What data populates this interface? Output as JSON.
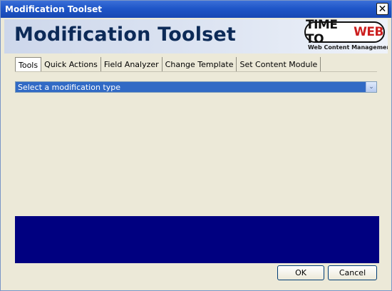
{
  "window": {
    "title": "Modification Toolset",
    "close_glyph": "✕"
  },
  "header": {
    "title": "Modification Toolset",
    "logo": {
      "part1": "TIME TO ",
      "part2": "WEB",
      "tagline": "Web Content Management"
    }
  },
  "tabs": [
    {
      "label": "Tools",
      "active": true
    },
    {
      "label": "Quick Actions",
      "active": false
    },
    {
      "label": "Field Analyzer",
      "active": false
    },
    {
      "label": "Change Template",
      "active": false
    },
    {
      "label": "Set Content Module",
      "active": false
    }
  ],
  "modification_select": {
    "selected": "Select a modification type",
    "arrow_glyph": "⌄"
  },
  "footer": {
    "ok_label": "OK",
    "cancel_label": "Cancel"
  },
  "colors": {
    "titlebar": "#1f56c8",
    "header_title": "#0c2a57",
    "select_highlight": "#316ac5",
    "panel": "#000080",
    "logo_accent": "#cc1f1f"
  },
  "icons": {
    "close": "close-icon",
    "dropdown": "chevron-down-icon"
  }
}
